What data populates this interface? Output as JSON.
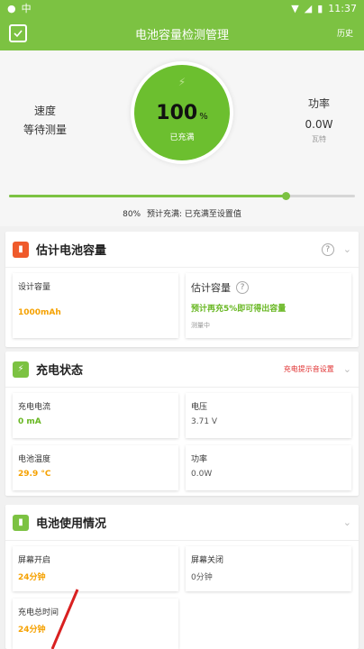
{
  "status_bar": {
    "carrier": "中",
    "time": "11:37"
  },
  "app_bar": {
    "title": "电池容量检测管理",
    "history": "历史"
  },
  "hero": {
    "speed_label": "速度",
    "speed_value": "等待测量",
    "percent": "100",
    "percent_sign": "%",
    "state": "已充满",
    "power_label": "功率",
    "power_value": "0.0W",
    "power_unit": "瓦特",
    "target_level": 0.8,
    "target_percent": "80%",
    "target_text": "预计充满: 已充满至设置值"
  },
  "capacity": {
    "title": "估计电池容量",
    "design_label": "设计容量",
    "design_value": "1000mAh",
    "estimate_label": "估计容量",
    "estimate_value": "预计再充5%即可得出容量",
    "estimate_note": "测量中"
  },
  "charge": {
    "title": "充电状态",
    "alert_link": "充电提示音设置",
    "current_label": "充电电流",
    "current_value": "0 mA",
    "voltage_label": "电压",
    "voltage_value": "3.71 V",
    "temp_label": "电池温度",
    "temp_value": "29.9 °C",
    "power_label": "功率",
    "power_value": "0.0W"
  },
  "usage": {
    "title": "电池使用情况",
    "screen_on_label": "屏幕开启",
    "screen_on_value": "24分钟",
    "screen_off_label": "屏幕关闭",
    "screen_off_value": "0分钟",
    "charge_total_label": "充电总时间",
    "charge_total_value": "24分钟"
  },
  "colors": {
    "brand": "#7cc242",
    "orange": "#f5a100",
    "red": "#e03232"
  },
  "icons": {
    "signal": "location-icon",
    "wifi": "wifi-icon",
    "battery": "battery-status-icon",
    "app": "shield-check-icon",
    "capacity": "battery-box-icon",
    "charge": "bolt-icon",
    "usage": "battery-icon"
  }
}
